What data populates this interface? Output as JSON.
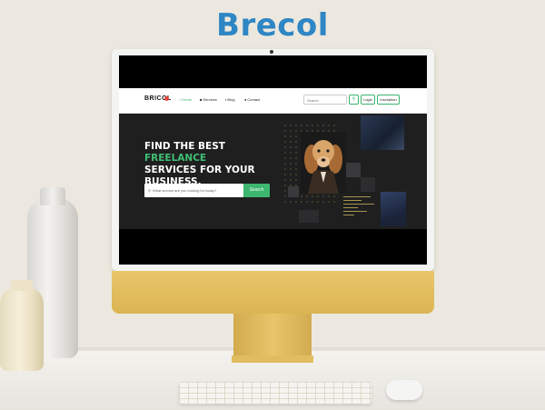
{
  "brand": {
    "title": "Brecol"
  },
  "website": {
    "logo": "BRICOL",
    "nav": [
      {
        "label": "Home",
        "icon": "home-icon",
        "active": true
      },
      {
        "label": "Services",
        "icon": "briefcase-icon",
        "active": false
      },
      {
        "label": "Blog",
        "icon": "book-icon",
        "active": false
      },
      {
        "label": "Contact",
        "icon": "user-icon",
        "active": false
      }
    ],
    "search_placeholder": "Search",
    "login_label": "Login",
    "signup_label": "Inscription",
    "hero": {
      "line1": "FIND THE BEST ",
      "highlight": "FREELANCE",
      "line2": "SERVICES FOR YOUR",
      "line3": "BUSINESS.",
      "search_placeholder": "What service are you looking for today?",
      "search_button": "Search"
    }
  },
  "colors": {
    "accent": "#3db66f",
    "brand_title": "#2f86c4",
    "monitor_chin": "#e8c66a"
  }
}
